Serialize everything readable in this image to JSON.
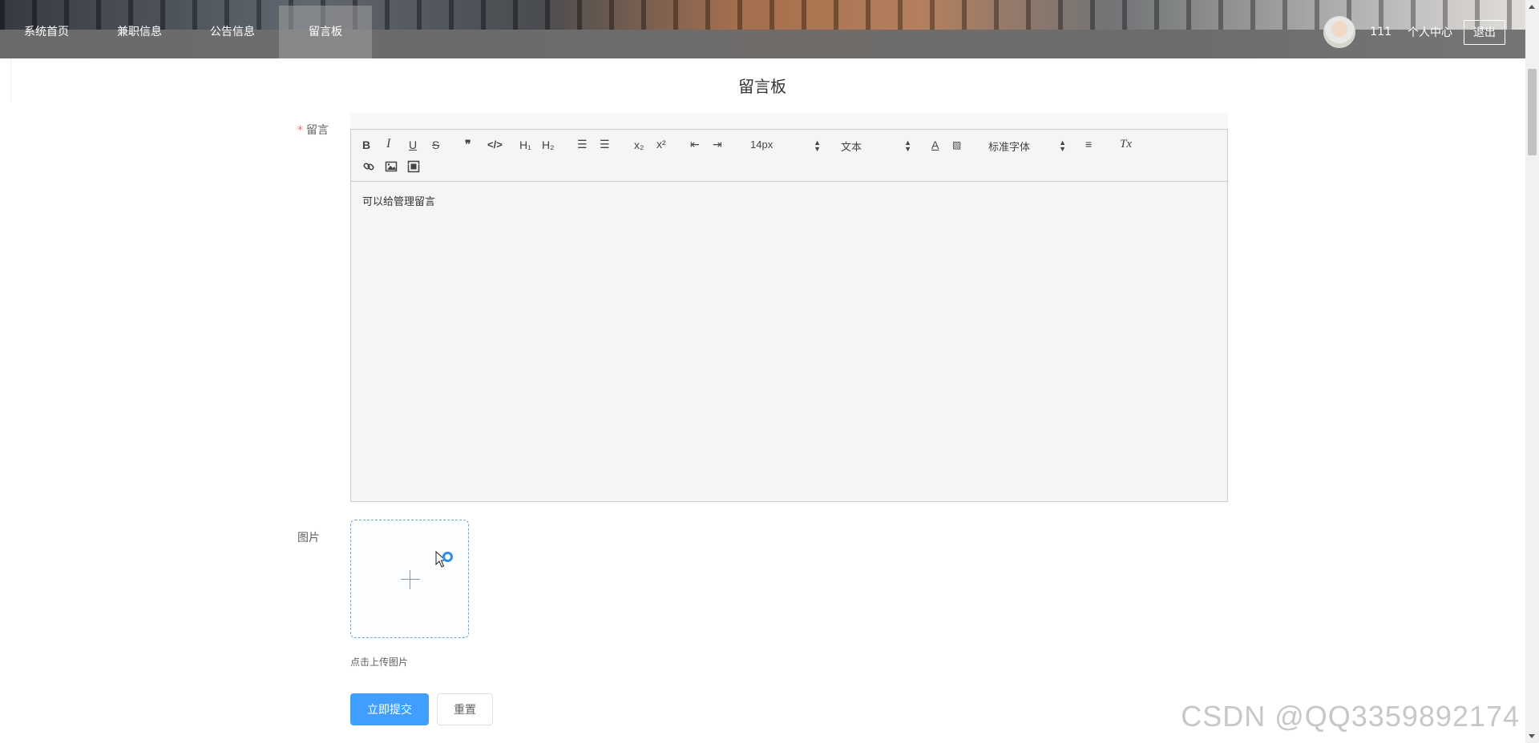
{
  "nav": {
    "items": [
      {
        "label": "系统首页"
      },
      {
        "label": "兼职信息"
      },
      {
        "label": "公告信息"
      },
      {
        "label": "留言板",
        "active": true
      }
    ]
  },
  "user": {
    "name": "111",
    "center_label": "个人中心",
    "logout_label": "退出"
  },
  "page": {
    "title": "留言板"
  },
  "form": {
    "message_label": "留言",
    "message_required_mark": "*",
    "image_label": "图片",
    "upload_tip": "点击上传图片",
    "submit_label": "立即提交",
    "reset_label": "重置"
  },
  "editor": {
    "toolbar": {
      "bold": "B",
      "italic": "I",
      "underline": "U",
      "strike": "S",
      "blockquote": "❞",
      "code": "</>",
      "h1": "H₁",
      "h2": "H₂",
      "ordered_list": "☰",
      "bullet_list": "☰",
      "subscript": "x₂",
      "superscript": "x²",
      "outdent": "⇤",
      "indent": "⇥",
      "size_value": "14px",
      "header_value": "文本",
      "font_value": "标准字体",
      "clean": "Tx"
    },
    "content": "可以给管理留言"
  },
  "watermark": "CSDN @QQ3359892174",
  "colors": {
    "primary": "#409eff",
    "required": "#f56c6c",
    "nav_band": "#6e6e6e"
  }
}
